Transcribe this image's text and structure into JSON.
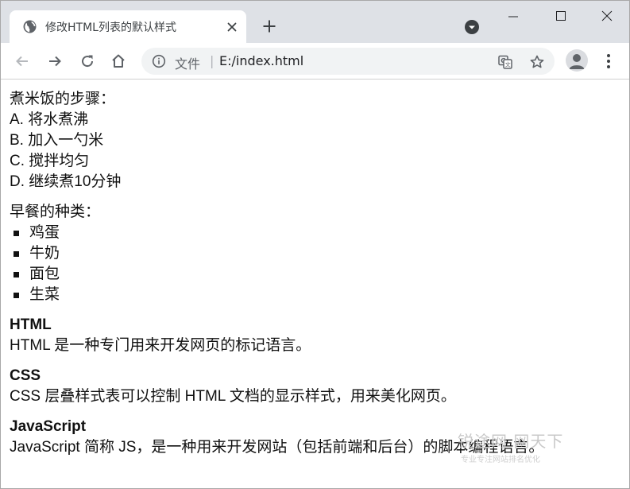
{
  "browser": {
    "tab_title": "修改HTML列表的默认样式",
    "address_label": "文件",
    "address_separator": "|",
    "url": "E:/index.html"
  },
  "content": {
    "ordered": {
      "title": "煮米饭的步骤：",
      "items": [
        "A. 将水煮沸",
        "B. 加入一勺米",
        "C. 搅拌均匀",
        "D. 继续煮10分钟"
      ]
    },
    "unordered": {
      "title": "早餐的种类：",
      "items": [
        "鸡蛋",
        "牛奶",
        "面包",
        "生菜"
      ]
    },
    "definitions": [
      {
        "term": "HTML",
        "desc": "HTML 是一种专门用来开发网页的标记语言。"
      },
      {
        "term": "CSS",
        "desc": "CSS 层叠样式表可以控制 HTML 文档的显示样式，用来美化网页。"
      },
      {
        "term": "JavaScript",
        "desc": "JavaScript 简称 JS，是一种用来开发网站（包括前端和后台）的脚本编程语言。"
      }
    ]
  },
  "watermark": {
    "main": "锐途网  网天下",
    "sub": "专业专注网站排名优化"
  },
  "icons": {
    "favicon": "globe-icon",
    "close": "close-icon",
    "new_tab": "plus-icon",
    "tab_search": "tab-search-icon",
    "back": "back-arrow-icon",
    "forward": "forward-arrow-icon",
    "reload": "reload-icon",
    "home": "home-icon",
    "info": "info-icon",
    "translate": "translate-icon",
    "bookmark": "star-icon",
    "profile": "avatar-icon",
    "menu": "kebab-menu-icon"
  },
  "colors": {
    "tabstrip": "#dee1e6",
    "omnibox": "#f1f3f4",
    "text": "#111111"
  }
}
